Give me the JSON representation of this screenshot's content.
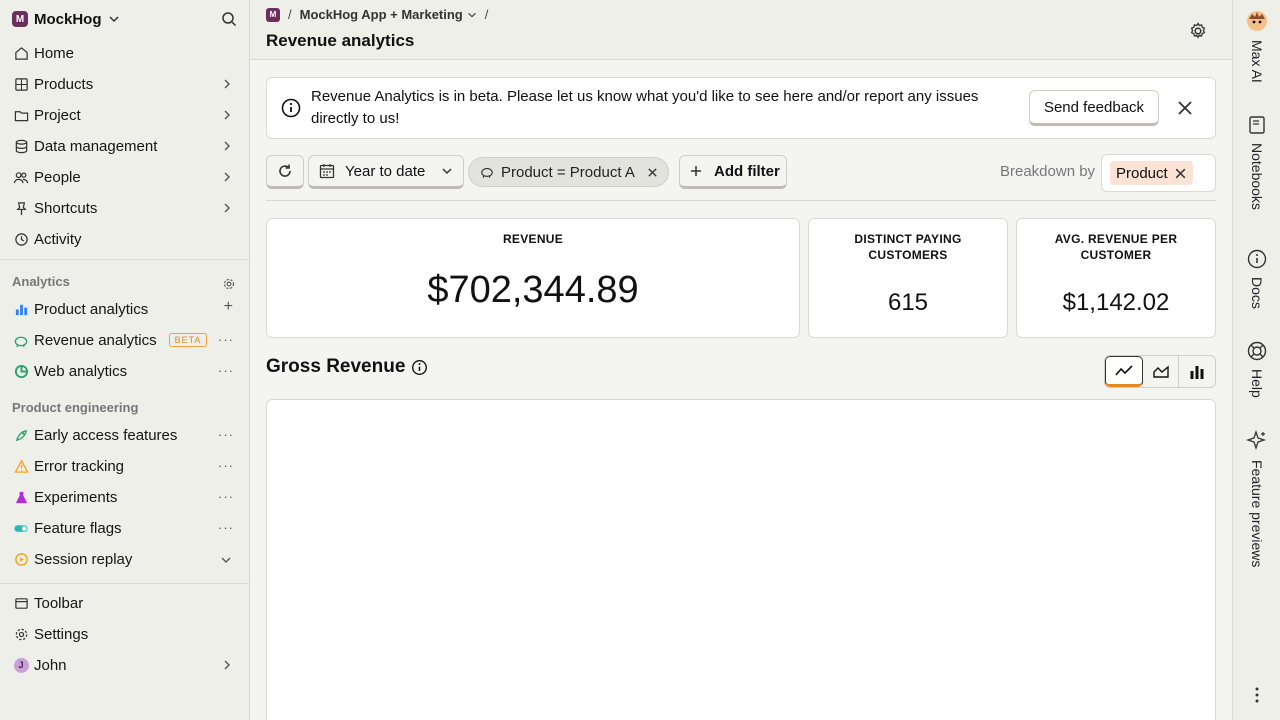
{
  "org": {
    "badge": "M",
    "name": "MockHog"
  },
  "sidebar": {
    "top_items": [
      {
        "label": "Home"
      },
      {
        "label": "Products"
      },
      {
        "label": "Project"
      },
      {
        "label": "Data management"
      },
      {
        "label": "People"
      },
      {
        "label": "Shortcuts"
      },
      {
        "label": "Activity"
      }
    ],
    "analytics_title": "Analytics",
    "analytics_items": [
      {
        "label": "Product analytics"
      },
      {
        "label": "Revenue analytics",
        "badge": "BETA"
      },
      {
        "label": "Web analytics"
      }
    ],
    "engineering_title": "Product engineering",
    "engineering_items": [
      {
        "label": "Early access features"
      },
      {
        "label": "Error tracking"
      },
      {
        "label": "Experiments"
      },
      {
        "label": "Feature flags"
      },
      {
        "label": "Session replay"
      }
    ],
    "bottom_items": [
      {
        "label": "Toolbar"
      },
      {
        "label": "Settings"
      },
      {
        "label": "John",
        "avatar": "J"
      }
    ]
  },
  "header": {
    "project_badge": "M",
    "separator": "/",
    "project_name": "MockHog App + Marketing",
    "title": "Revenue analytics"
  },
  "banner": {
    "text": "Revenue Analytics is in beta. Please let us know what you'd like to see here and/or report any issues directly to us!",
    "button": "Send feedback"
  },
  "filters": {
    "date_range": "Year to date",
    "product_filter": "Product = Product A",
    "add_filter": "Add filter",
    "breakdown_label": "Breakdown by",
    "breakdown_value": "Product"
  },
  "stats": [
    {
      "label": "REVENUE",
      "value": "$702,344.89"
    },
    {
      "label": "DISTINCT PAYING CUSTOMERS",
      "value": "615"
    },
    {
      "label": "AVG. REVENUE PER CUSTOMER",
      "value": "$1,142.02"
    }
  ],
  "gross_revenue": {
    "title": "Gross Revenue",
    "active_view": "line"
  },
  "rail": [
    {
      "label": "Max AI"
    },
    {
      "label": "Notebooks"
    },
    {
      "label": "Docs"
    },
    {
      "label": "Help"
    },
    {
      "label": "Feature previews"
    }
  ],
  "colors": {
    "accent": "#e08a20",
    "org_badge": "#6b2f5e",
    "breakdown_tag": "#fde3d6"
  }
}
